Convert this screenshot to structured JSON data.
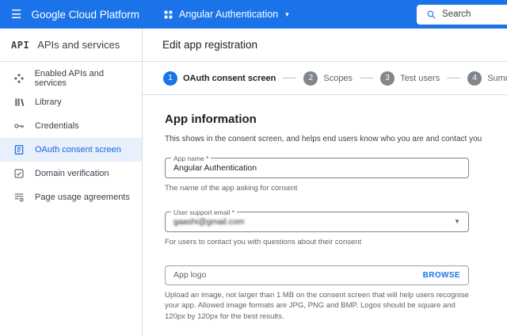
{
  "colors": {
    "header_blue": "#1a73e8",
    "accent_blue": "#1a73e8",
    "selected_item_bg": "#e8f0fe",
    "selected_item_text": "#1967d2"
  },
  "header": {
    "brand": "Google Cloud Platform",
    "project_name": "Angular Authentication",
    "search_label": "Search"
  },
  "sidebar": {
    "logo_text": "API",
    "title": "APIs and services",
    "items": [
      {
        "label": "Enabled APIs and services",
        "icon": "enabled-apis-icon",
        "selected": false
      },
      {
        "label": "Library",
        "icon": "library-icon",
        "selected": false
      },
      {
        "label": "Credentials",
        "icon": "credentials-icon",
        "selected": false
      },
      {
        "label": "OAuth consent screen",
        "icon": "oauth-consent-icon",
        "selected": true
      },
      {
        "label": "Domain verification",
        "icon": "domain-verification-icon",
        "selected": false
      },
      {
        "label": "Page usage agreements",
        "icon": "page-usage-icon",
        "selected": false
      }
    ]
  },
  "main": {
    "page_title": "Edit app registration",
    "stepper": [
      {
        "number": "1",
        "label": "OAuth consent screen",
        "active": true
      },
      {
        "number": "2",
        "label": "Scopes",
        "active": false
      },
      {
        "number": "3",
        "label": "Test users",
        "active": false
      },
      {
        "number": "4",
        "label": "Summary",
        "active": false
      }
    ],
    "section": {
      "title": "App information",
      "description": "This shows in the consent screen, and helps end users know who you are and contact you"
    },
    "fields": {
      "app_name": {
        "label": "App name *",
        "value": "Angular Authentication",
        "helper": "The name of the app asking for consent"
      },
      "support_email": {
        "label": "User support email *",
        "value": "gaashi@gmail.com",
        "helper": "For users to contact you with questions about their consent"
      },
      "app_logo": {
        "placeholder": "App logo",
        "browse_label": "BROWSE",
        "helper": "Upload an image, not larger than 1 MB on the consent screen that will help users recognise your app. Allowed image formats are JPG, PNG and BMP. Logos should be square and 120px by 120px for the best results."
      }
    }
  }
}
